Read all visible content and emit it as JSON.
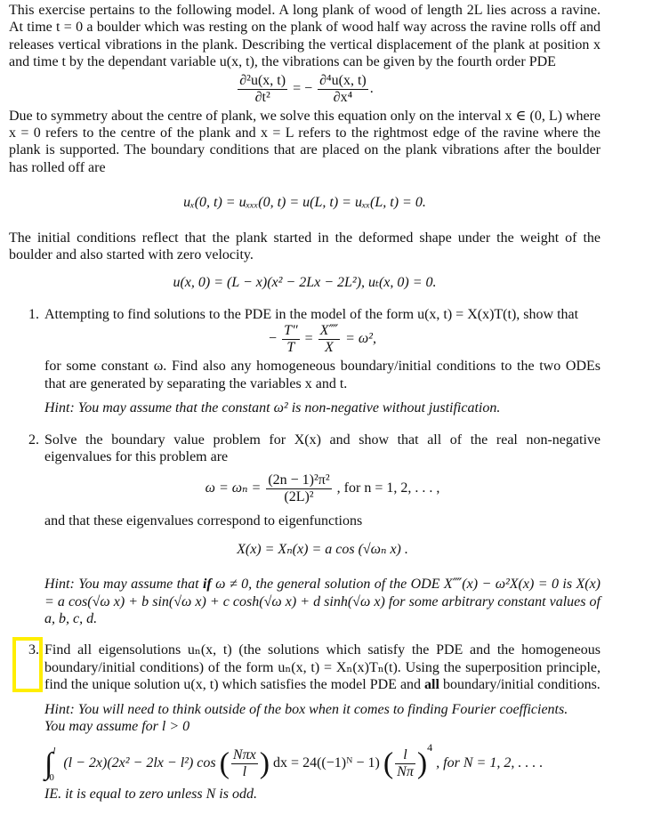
{
  "intro": {
    "p1": "This exercise pertains to the following model. A long plank of wood of length 2L lies across a ravine. At time t = 0 a boulder which was resting on the plank of wood half way across the ravine rolls off and releases vertical vibrations in the plank. Describing the vertical displacement of the plank at position x and time t by the dependant variable u(x, t), the vibrations can be given by the fourth order PDE",
    "pde": {
      "lhs_num": "∂²u(x, t)",
      "lhs_den": "∂t²",
      "eq": "= −",
      "rhs_num": "∂⁴u(x, t)",
      "rhs_den": "∂x⁴",
      "end": "."
    },
    "p2": "Due to symmetry about the centre of plank, we solve this equation only on the interval x ∈ (0, L) where x = 0 refers to the centre of the plank and x = L refers to the rightmost edge of the ravine where the plank is supported. The boundary conditions that are placed on the plank vibrations after the boulder has rolled off are",
    "bc": "uₓ(0, t) = uₓₓₓ(0, t) = u(L, t) = uₓₓ(L, t) = 0.",
    "p3": "The initial conditions reflect that the plank started in the deformed shape under the weight of the boulder and also started with zero velocity.",
    "ic": "u(x, 0) = (L − x)(x² − 2Lx − 2L²),    uₜ(x, 0) = 0."
  },
  "items": [
    {
      "number": "1.",
      "text1": "Attempting to find solutions to the PDE in the model of the form u(x, t) = X(x)T(t), show that",
      "eq": {
        "minus": "−",
        "a_num": "T″",
        "a_den": "T",
        "eq1": "=",
        "b_num": "X⁗",
        "b_den": "X",
        "rest": "= ω²,"
      },
      "text2": "for some constant ω. Find also any homogeneous boundary/initial conditions to the two ODEs that are generated by separating the variables x and t.",
      "hint": "Hint: You may assume that the constant ω² is non-negative without justification."
    },
    {
      "number": "2.",
      "text1": "Solve the boundary value problem for X(x) and show that all of the real non-negative eigenvalues for this problem are",
      "eq": {
        "lhs": "ω = ωₙ =",
        "num": "(2n − 1)²π²",
        "den": "(2L)²",
        "rest": ",   for n = 1, 2, . . . ,"
      },
      "text2": "and that these eigenvalues correspond to eigenfunctions",
      "eigenfunction": "X(x) = Xₙ(x) = a cos (√ωₙ x) .",
      "hint_pre": "Hint: You may assume that ",
      "hint_bold": "if",
      "hint_post": " ω ≠ 0, the general solution of the ODE X⁗(x) − ω²X(x) = 0 is X(x) = a cos(√ω x) + b sin(√ω x) + c cosh(√ω x) + d sinh(√ω x) for some arbitrary constant values of a, b, c, d."
    },
    {
      "number": "3.",
      "text_pre": "Find all eigensolutions uₙ(x, t) (the solutions which satisfy the PDE and the homogeneous boundary/initial conditions) of the form uₙ(x, t) = Xₙ(x)Tₙ(t). Using the superposition principle, find the unique solution u(x, t) which satisfies the model PDE and ",
      "text_bold": "all",
      "text_post": " boundary/initial conditions.",
      "hint1": "Hint: You will need to think outside of the box when it comes to finding Fourier coefficients.",
      "hint2": "You may assume for l > 0",
      "integral": {
        "upper": "l",
        "lower": "0",
        "integrand": "(l − 2x)(2x² − 2lx − l²) cos",
        "cos_num": "Nπx",
        "cos_den": "l",
        "mid": "dx = 24((−1)ᴺ − 1)",
        "frac_num": "l",
        "frac_den": "Nπ",
        "power": "4",
        "tail": ",    for N = 1, 2, . . . ."
      },
      "hint3": "IE. it is equal to zero unless N is odd."
    }
  ],
  "annotation": {
    "highlight_color": "#ffee00",
    "target": "item-3-number"
  }
}
